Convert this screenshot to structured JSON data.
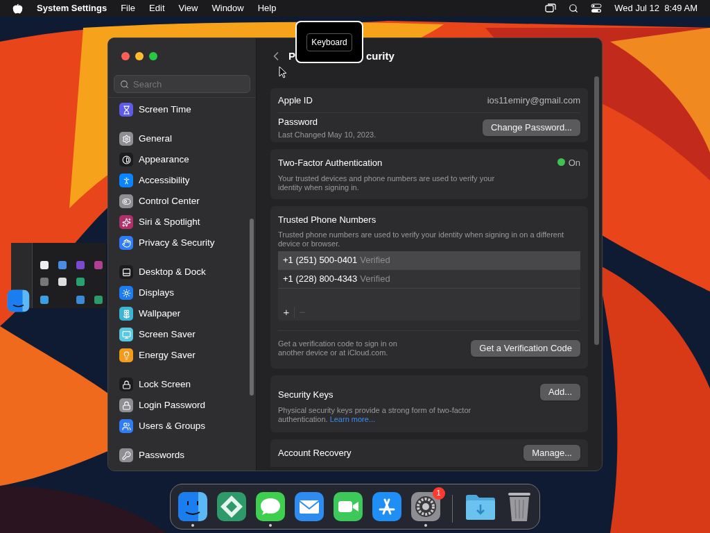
{
  "menubar": {
    "app": "System Settings",
    "menus": [
      "File",
      "Edit",
      "View",
      "Window",
      "Help"
    ],
    "clock": "Wed Jul 12  8:49 AM"
  },
  "sidebar": {
    "search_placeholder": "Search",
    "groups": [
      [
        {
          "label": "Screen Time",
          "selected": false,
          "color": "#5e5ce6"
        }
      ],
      [
        {
          "label": "General",
          "selected": false,
          "color": "#8e8e93"
        },
        {
          "label": "Appearance",
          "selected": false,
          "color": "#1c1c1e"
        },
        {
          "label": "Accessibility",
          "selected": false,
          "color": "#0a84ff"
        },
        {
          "label": "Control Center",
          "selected": false,
          "color": "#8e8e93"
        },
        {
          "label": "Siri & Spotlight",
          "selected": false,
          "color": "#b0306a"
        },
        {
          "label": "Privacy & Security",
          "selected": false,
          "color": "#2f7cf6"
        }
      ],
      [
        {
          "label": "Desktop & Dock",
          "selected": false,
          "color": "#1c1c1e"
        },
        {
          "label": "Displays",
          "selected": false,
          "color": "#1e7cf2"
        },
        {
          "label": "Wallpaper",
          "selected": false,
          "color": "#3bb5d6"
        },
        {
          "label": "Screen Saver",
          "selected": false,
          "color": "#5ac8e0"
        },
        {
          "label": "Energy Saver",
          "selected": false,
          "color": "#f29b1d"
        }
      ],
      [
        {
          "label": "Lock Screen",
          "selected": false,
          "color": "#1c1c1e"
        },
        {
          "label": "Login Password",
          "selected": false,
          "color": "#8e8e93"
        },
        {
          "label": "Users & Groups",
          "selected": false,
          "color": "#2f7cf6"
        }
      ],
      [
        {
          "label": "Passwords",
          "selected": false,
          "color": "#8e8e93"
        }
      ]
    ]
  },
  "header": {
    "title_start": "P",
    "title_end": "curity"
  },
  "tooltip": "Keyboard",
  "apple_id": {
    "label": "Apple ID",
    "value": "ios11emiry@gmail.com"
  },
  "password": {
    "label": "Password",
    "note": "Last Changed May 10, 2023.",
    "button": "Change Password..."
  },
  "two_factor": {
    "label": "Two-Factor Authentication",
    "status": "On",
    "on": true,
    "description": "Your trusted devices and phone numbers are used to verify your identity when signing in."
  },
  "trusted_numbers": {
    "title": "Trusted Phone Numbers",
    "description": "Trusted phone numbers are used to verify your identity when signing in on a different device or browser.",
    "numbers": [
      {
        "number": "+1 (251) 500-0401",
        "status": "Verified",
        "selected": true
      },
      {
        "number": "+1 (228) 800-4343",
        "status": "Verified",
        "selected": false
      }
    ],
    "add": "+",
    "remove": "−",
    "remove_disabled": true
  },
  "verification": {
    "description": "Get a verification code to sign in on another device or at iCloud.com.",
    "button": "Get a Verification Code"
  },
  "security_keys": {
    "title": "Security Keys",
    "description": "Physical security keys provide a strong form of two-factor authentication.",
    "link": "Learn more...",
    "button": "Add..."
  },
  "account_recovery": {
    "label": "Account Recovery",
    "button": "Manage..."
  },
  "dock": {
    "items": [
      {
        "kind": "finder",
        "running": true
      },
      {
        "kind": "diamond",
        "running": false
      },
      {
        "kind": "messages",
        "running": true
      },
      {
        "kind": "mail",
        "running": false
      },
      {
        "kind": "facetime",
        "running": false
      },
      {
        "kind": "appstore",
        "running": false
      },
      {
        "kind": "settings",
        "running": true,
        "badge": "1"
      },
      {
        "kind": "separator"
      },
      {
        "kind": "downloads",
        "running": false
      },
      {
        "kind": "trash",
        "running": false
      }
    ]
  }
}
